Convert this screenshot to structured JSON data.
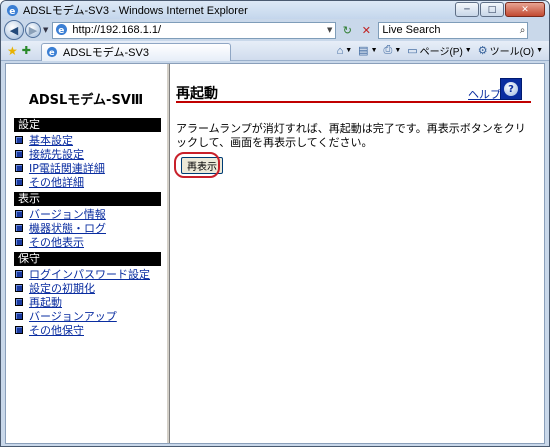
{
  "window": {
    "title": "ADSLモデム-SV3 - Windows Internet Explorer",
    "minimize": "─",
    "maximize": "□",
    "close": "✕"
  },
  "browser": {
    "url": "http://192.168.1.1/",
    "search_placeholder": "Live Search",
    "tab_title": "ADSLモデム-SV3",
    "tools": {
      "page_label": "ページ(P)",
      "tools_label": "ツール(O)"
    }
  },
  "sidebar": {
    "logo": "ADSLモデム-SVⅢ",
    "sections": [
      {
        "header": "設定",
        "items": [
          "基本設定",
          "接続先設定",
          "IP電話関連詳細",
          "その他詳細"
        ]
      },
      {
        "header": "表示",
        "items": [
          "バージョン情報",
          "機器状態・ログ",
          "その他表示"
        ]
      },
      {
        "header": "保守",
        "items": [
          "ログインパスワード設定",
          "設定の初期化",
          "再起動",
          "バージョンアップ",
          "その他保守"
        ]
      }
    ]
  },
  "main": {
    "title": "再起動",
    "help_label": "ヘルプ",
    "message": "アラームランプが消灯すれば、再起動は完了です。再表示ボタンをクリックして、画面を再表示してください。",
    "reload_button": "再表示"
  },
  "colors": {
    "title_rule": "#c00000",
    "menu_header_bg": "#000000",
    "link": "#0a2da0",
    "highlight": "#c8202a"
  },
  "icons": {
    "back": "back-arrow-icon",
    "forward": "forward-arrow-icon",
    "refresh": "refresh-icon",
    "stop": "stop-icon",
    "search": "search-icon",
    "favorites": "star-icon",
    "add_favorite": "add-favorite-icon",
    "home": "home-icon",
    "feeds": "feeds-icon",
    "print": "print-icon",
    "help": "help-icon"
  }
}
